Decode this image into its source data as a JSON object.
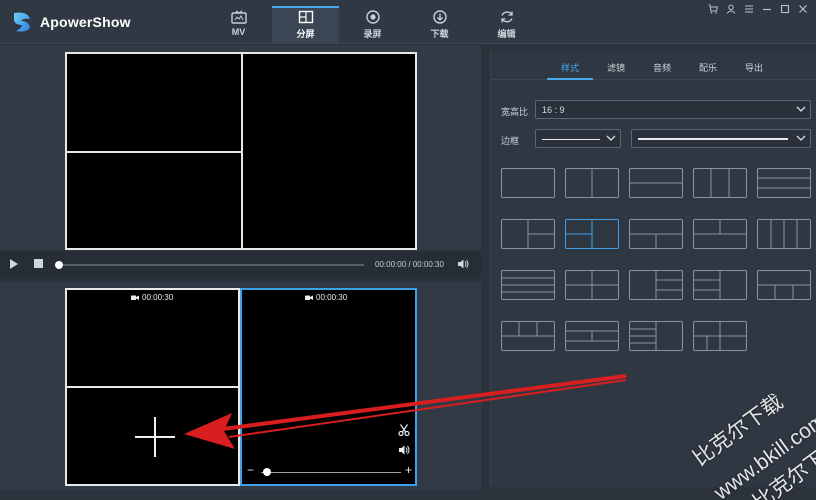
{
  "app": {
    "name": "ApowerShow"
  },
  "nav": [
    {
      "label": "MV",
      "icon": "tv-icon"
    },
    {
      "label": "分屏",
      "icon": "split-screen-icon",
      "active": true
    },
    {
      "label": "录屏",
      "icon": "record-icon"
    },
    {
      "label": "下载",
      "icon": "download-icon"
    },
    {
      "label": "编辑",
      "icon": "refresh-icon"
    }
  ],
  "player": {
    "timecode": "00:00:00 / 00:00:30",
    "progress": 0.0
  },
  "editor": {
    "left_duration": "00:00:30",
    "right_duration": "00:00:30"
  },
  "panel": {
    "tabs": [
      "样式",
      "滤镜",
      "音频",
      "配乐",
      "导出"
    ],
    "active_tab": "样式",
    "aspect_label": "宽高比",
    "aspect_value": "16 : 9",
    "border_label": "边框"
  },
  "watermark": {
    "line1": "比克尔下载",
    "line2": "www.bkill.com",
    "line3": "比克尔下载"
  },
  "colors": {
    "accent": "#3fa0ea",
    "arrow": "#d81e1e"
  }
}
